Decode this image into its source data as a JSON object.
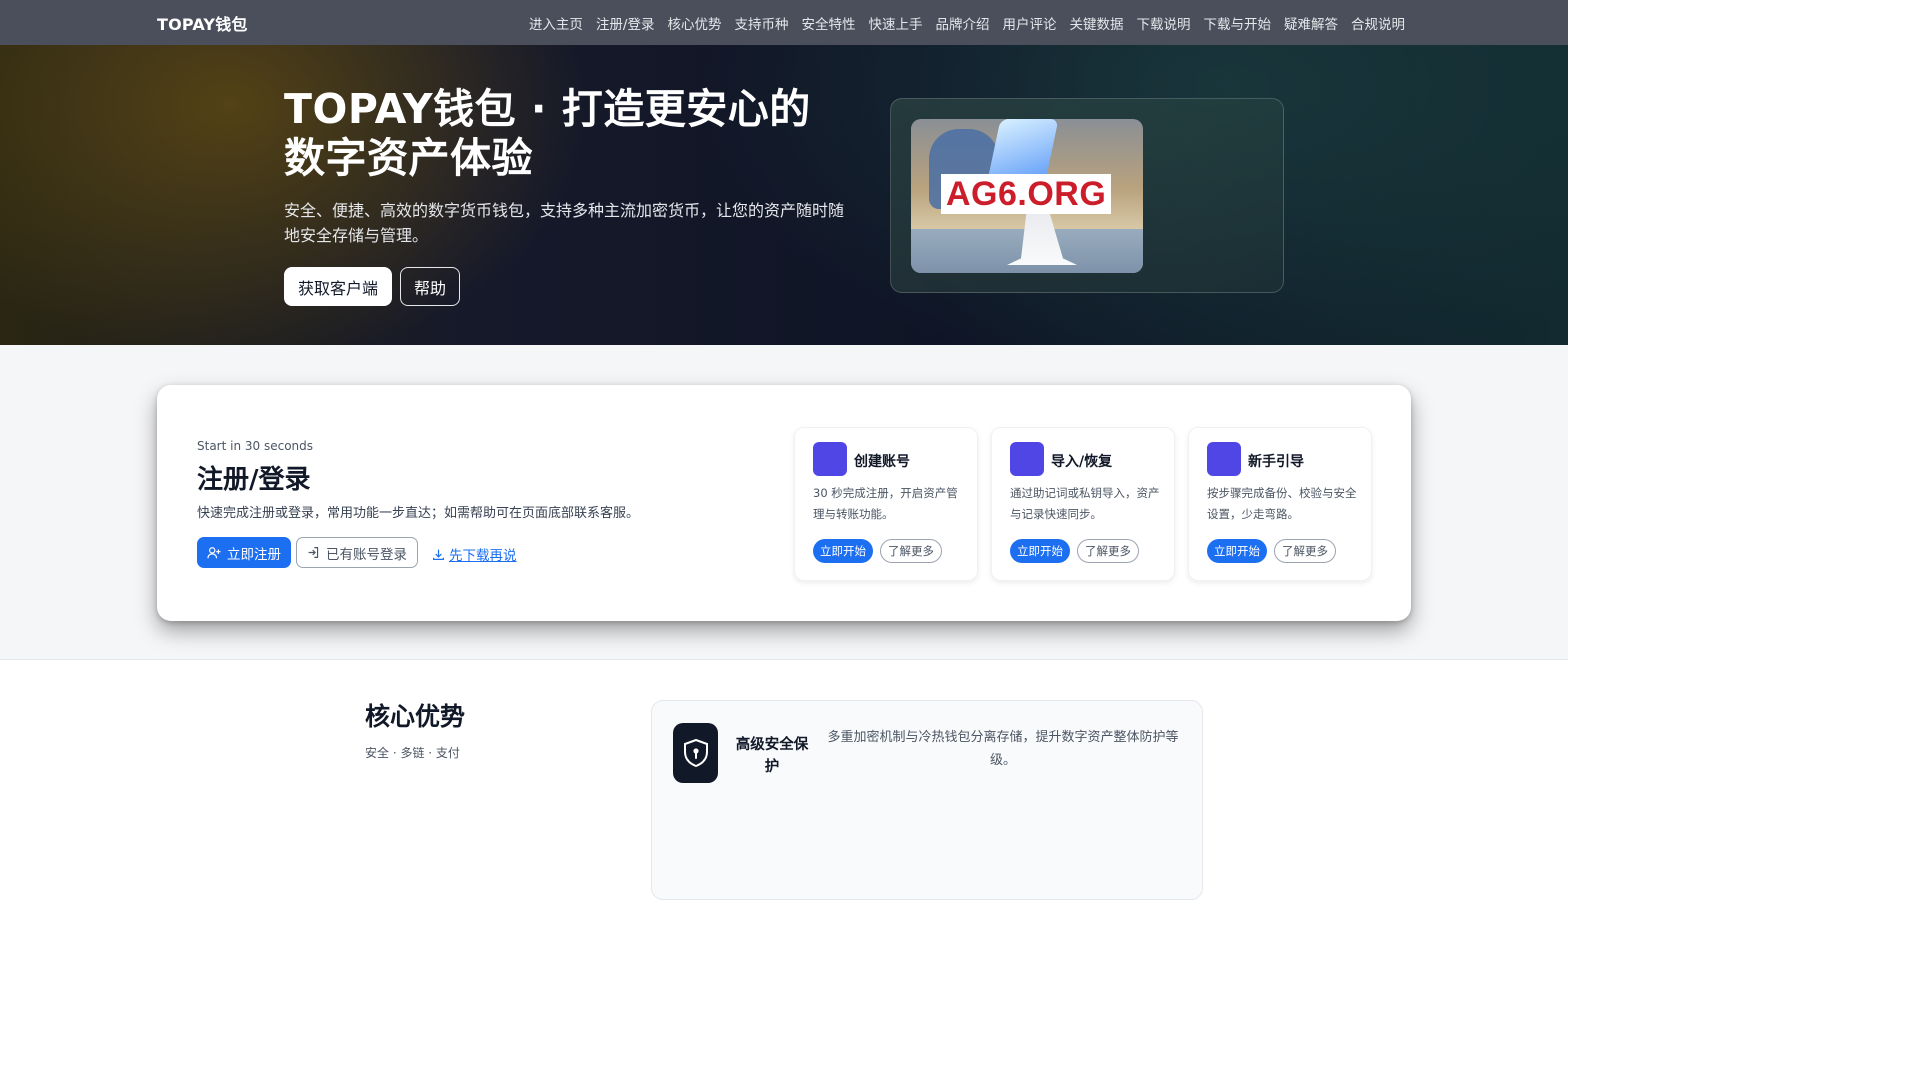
{
  "nav": {
    "brand": "TOPAY钱包",
    "links": [
      "进入主页",
      "注册/登录",
      "核心优势",
      "支持币种",
      "安全特性",
      "快速上手",
      "品牌介绍",
      "用户评论",
      "关键数据",
      "下载说明",
      "下载与开始",
      "疑难解答",
      "合规说明"
    ]
  },
  "hero": {
    "title": "TOPAY钱包 · 打造更安心的数字资产体验",
    "description": "安全、便捷、高效的数字货币钱包，支持多种主流加密货币，让您的资产随时随地安全存储与管理。",
    "primary_button": "获取客户端",
    "secondary_button": "帮助",
    "image_watermark": "AG6.ORG"
  },
  "signup": {
    "kicker": "Start in 30 seconds",
    "title": "注册/登录",
    "description": "快速完成注册或登录，常用功能一步直达；如需帮助可在页面底部联系客服。",
    "register_button": "立即注册",
    "login_button": "已有账号登录",
    "download_link": "先下载再说",
    "cards": [
      {
        "title": "创建账号",
        "description": "30 秒完成注册，开启资产管理与转账功能。",
        "start": "立即开始",
        "more": "了解更多"
      },
      {
        "title": "导入/恢复",
        "description": "通过助记词或私钥导入，资产与记录快速同步。",
        "start": "立即开始",
        "more": "了解更多"
      },
      {
        "title": "新手引导",
        "description": "按步骤完成备份、校验与安全设置，少走弯路。",
        "start": "立即开始",
        "more": "了解更多"
      }
    ]
  },
  "advantages": {
    "title": "核心优势",
    "subtitle": "安全 · 多链 · 支付",
    "feature": {
      "icon": "shield-icon",
      "title": "高级安全保护",
      "description": "多重加密机制与冷热钱包分离存储，提升数字资产整体防护等级。"
    }
  },
  "colors": {
    "nav_bg": "#4b4f5c",
    "primary": "#1d6ff2",
    "card_icon": "#4f46e5",
    "watermark": "#cc1d2a"
  }
}
